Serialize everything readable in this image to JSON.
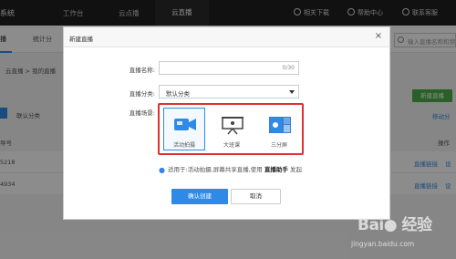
{
  "topnav": {
    "brand": "系统",
    "items": [
      "工作台",
      "云点播",
      "云直播"
    ],
    "right": [
      "相关下载",
      "帮助中心",
      "联系客服"
    ]
  },
  "subbar": {
    "tabs": [
      "播",
      "统计分"
    ],
    "search_placeholder": "输入直播名称和频"
  },
  "background": {
    "breadcrumb": "云直播 > 我的直播",
    "filter": "联认分类",
    "new_button": "新建直播",
    "move_link": "移动分",
    "header_col": "导号",
    "header_action": "操作",
    "rows": [
      {
        "id": "5218",
        "links": [
          "直播链接",
          "设"
        ]
      },
      {
        "id": "4934",
        "links": [
          "直播链接",
          "设"
        ]
      }
    ]
  },
  "modal": {
    "title": "新建直播",
    "close": "×",
    "name_label": "直播名称:",
    "name_value": "",
    "name_counter": "0/30",
    "category_label": "直播分类:",
    "category_value": "默认分类",
    "scene_label": "直播场景:",
    "scenes": [
      {
        "label": "活动拍摄",
        "icon": "camera-icon",
        "selected": true
      },
      {
        "label": "大班课",
        "icon": "presentation-board-icon",
        "selected": false
      },
      {
        "label": "三分屏",
        "icon": "split-screen-icon",
        "selected": false
      }
    ],
    "hint_prefix": "适用于:活动拍摄,屏幕共享直播,使用",
    "hint_bold": "直播助手",
    "hint_suffix": "发起",
    "confirm_label": "确认创建",
    "cancel_label": "取消"
  },
  "watermark": {
    "title": "Bai",
    "title_cn": "经验",
    "url": "jingyan.baidu.com"
  },
  "colors": {
    "accent": "#2e8ae6",
    "highlight": "#e03030",
    "green": "#49b04a",
    "topbar": "#1f1f1f"
  }
}
